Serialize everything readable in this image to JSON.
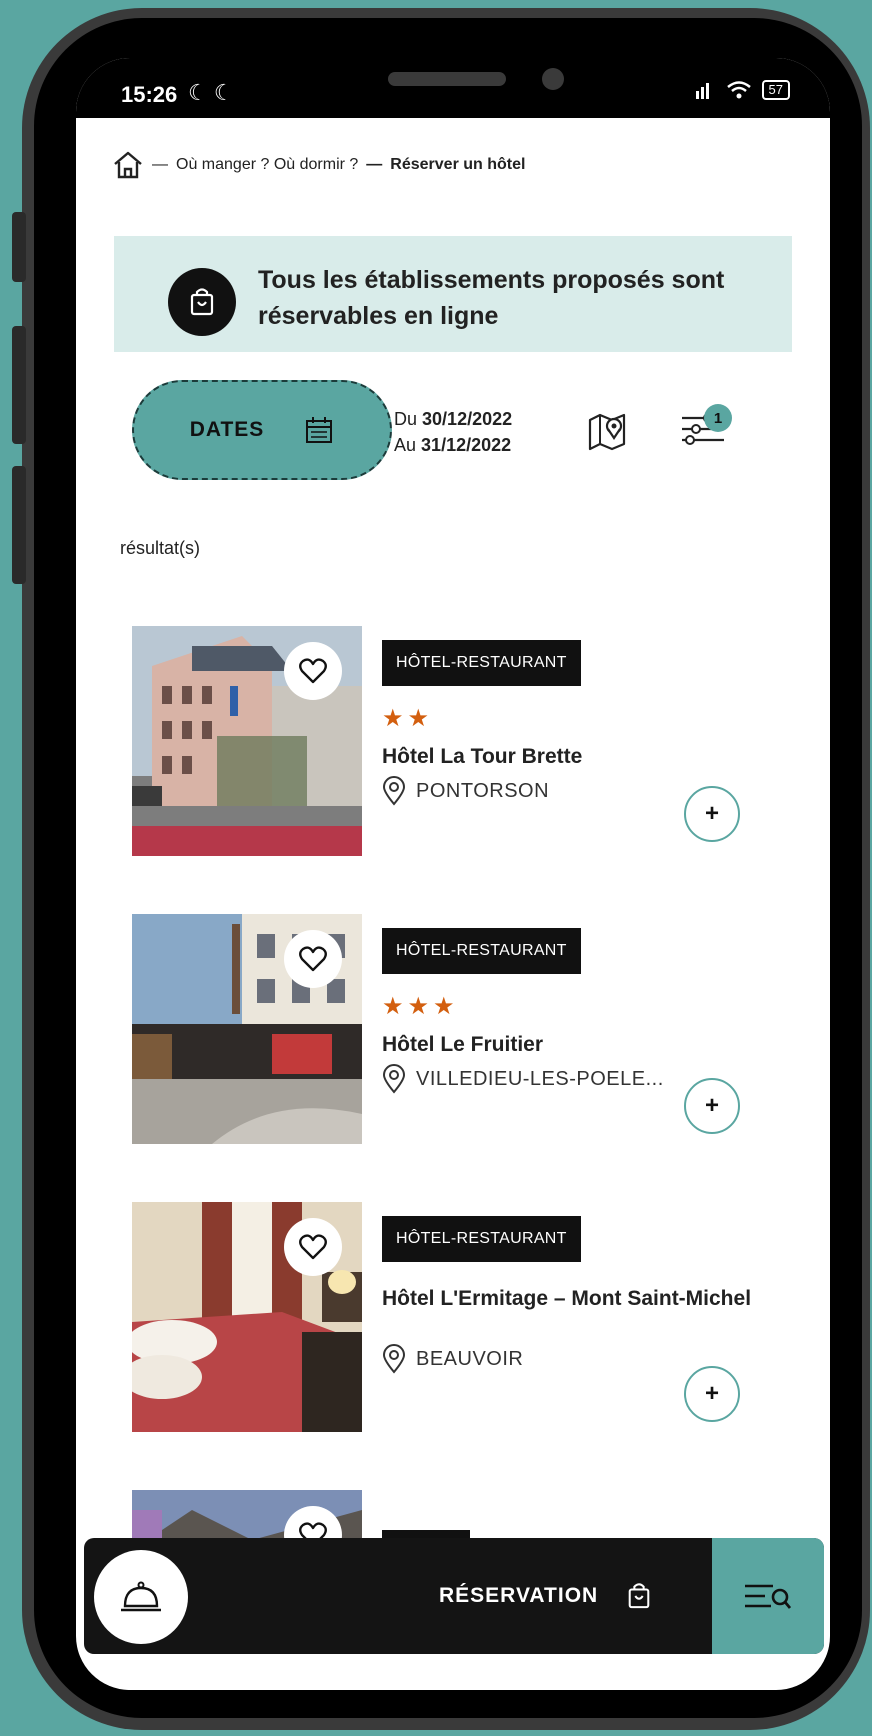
{
  "status": {
    "time": "15:26",
    "battery": "57"
  },
  "breadcrumb": {
    "separator1": "—",
    "parent": "Où manger ? Où dormir ?",
    "separator2": "—",
    "current": "Réserver un hôtel"
  },
  "banner": {
    "text": "Tous les établissements proposés sont réservables en ligne"
  },
  "dates": {
    "button_label": "DATES",
    "from_prefix": "Du",
    "from": "30/12/2022",
    "to_prefix": "Au",
    "to": "31/12/2022"
  },
  "filters": {
    "badge_count": "1"
  },
  "results_label": "résultat(s)",
  "hotels": [
    {
      "type": "HÔTEL-RESTAURANT",
      "stars": "★★",
      "name": "Hôtel La Tour Brette",
      "location": "PONTORSON"
    },
    {
      "type": "HÔTEL-RESTAURANT",
      "stars": "★★★",
      "name": "Hôtel Le Fruitier",
      "location": "VILLEDIEU-LES-POELE..."
    },
    {
      "type": "HÔTEL-RESTAURANT",
      "stars": "",
      "name": "Hôtel L'Ermitage – Mont Saint-Michel",
      "location": "BEAUVOIR"
    }
  ],
  "bottom_nav": {
    "reservation_label": "RÉSERVATION"
  },
  "colors": {
    "accent": "#5aa6a1",
    "banner_bg": "#d9ecea",
    "star": "#d35f0f",
    "dark": "#141414"
  }
}
